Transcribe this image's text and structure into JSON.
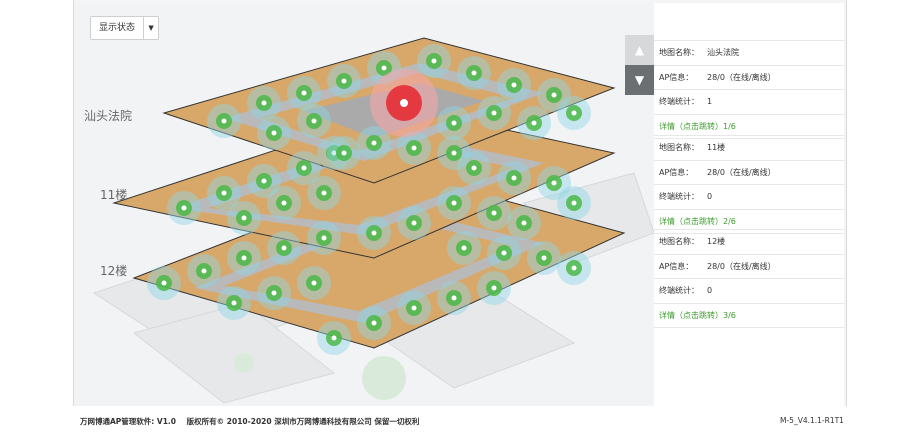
{
  "toolbar": {
    "display_status_label": "显示状态"
  },
  "floors": [
    {
      "label": "汕头法院"
    },
    {
      "label": "11楼"
    },
    {
      "label": "12楼"
    }
  ],
  "panel": {
    "cards": [
      {
        "name_key": "地图名称：",
        "name_val": "汕头法院",
        "ap_key": "AP信息：",
        "ap_val": "28/0（在线/离线）",
        "term_key": "终端统计：",
        "term_val": "1",
        "detail": "详情（点击跳转）1/6"
      },
      {
        "name_key": "地图名称：",
        "name_val": "11楼",
        "ap_key": "AP信息：",
        "ap_val": "28/0（在线/离线）",
        "term_key": "终端统计：",
        "term_val": "0",
        "detail": "详情（点击跳转）2/6"
      },
      {
        "name_key": "地图名称：",
        "name_val": "12楼",
        "ap_key": "AP信息：",
        "ap_val": "28/0（在线/离线）",
        "term_key": "终端统计：",
        "term_val": "0",
        "detail": "详情（点击跳转）3/6"
      }
    ]
  },
  "footer": {
    "software": "万网博通AP管理软件: V1.0",
    "copyright": "版权所有© 2010-2020 深圳市万网博通科技有限公司 保留一切权利",
    "version": "M-5_V4.1.1-R1T1"
  },
  "colors": {
    "accent": "#2b8ad6",
    "link": "#3c9b2c",
    "alert": "#e8262f",
    "ap_green": "#4bb848",
    "ap_cyan": "#8fd6e6"
  }
}
